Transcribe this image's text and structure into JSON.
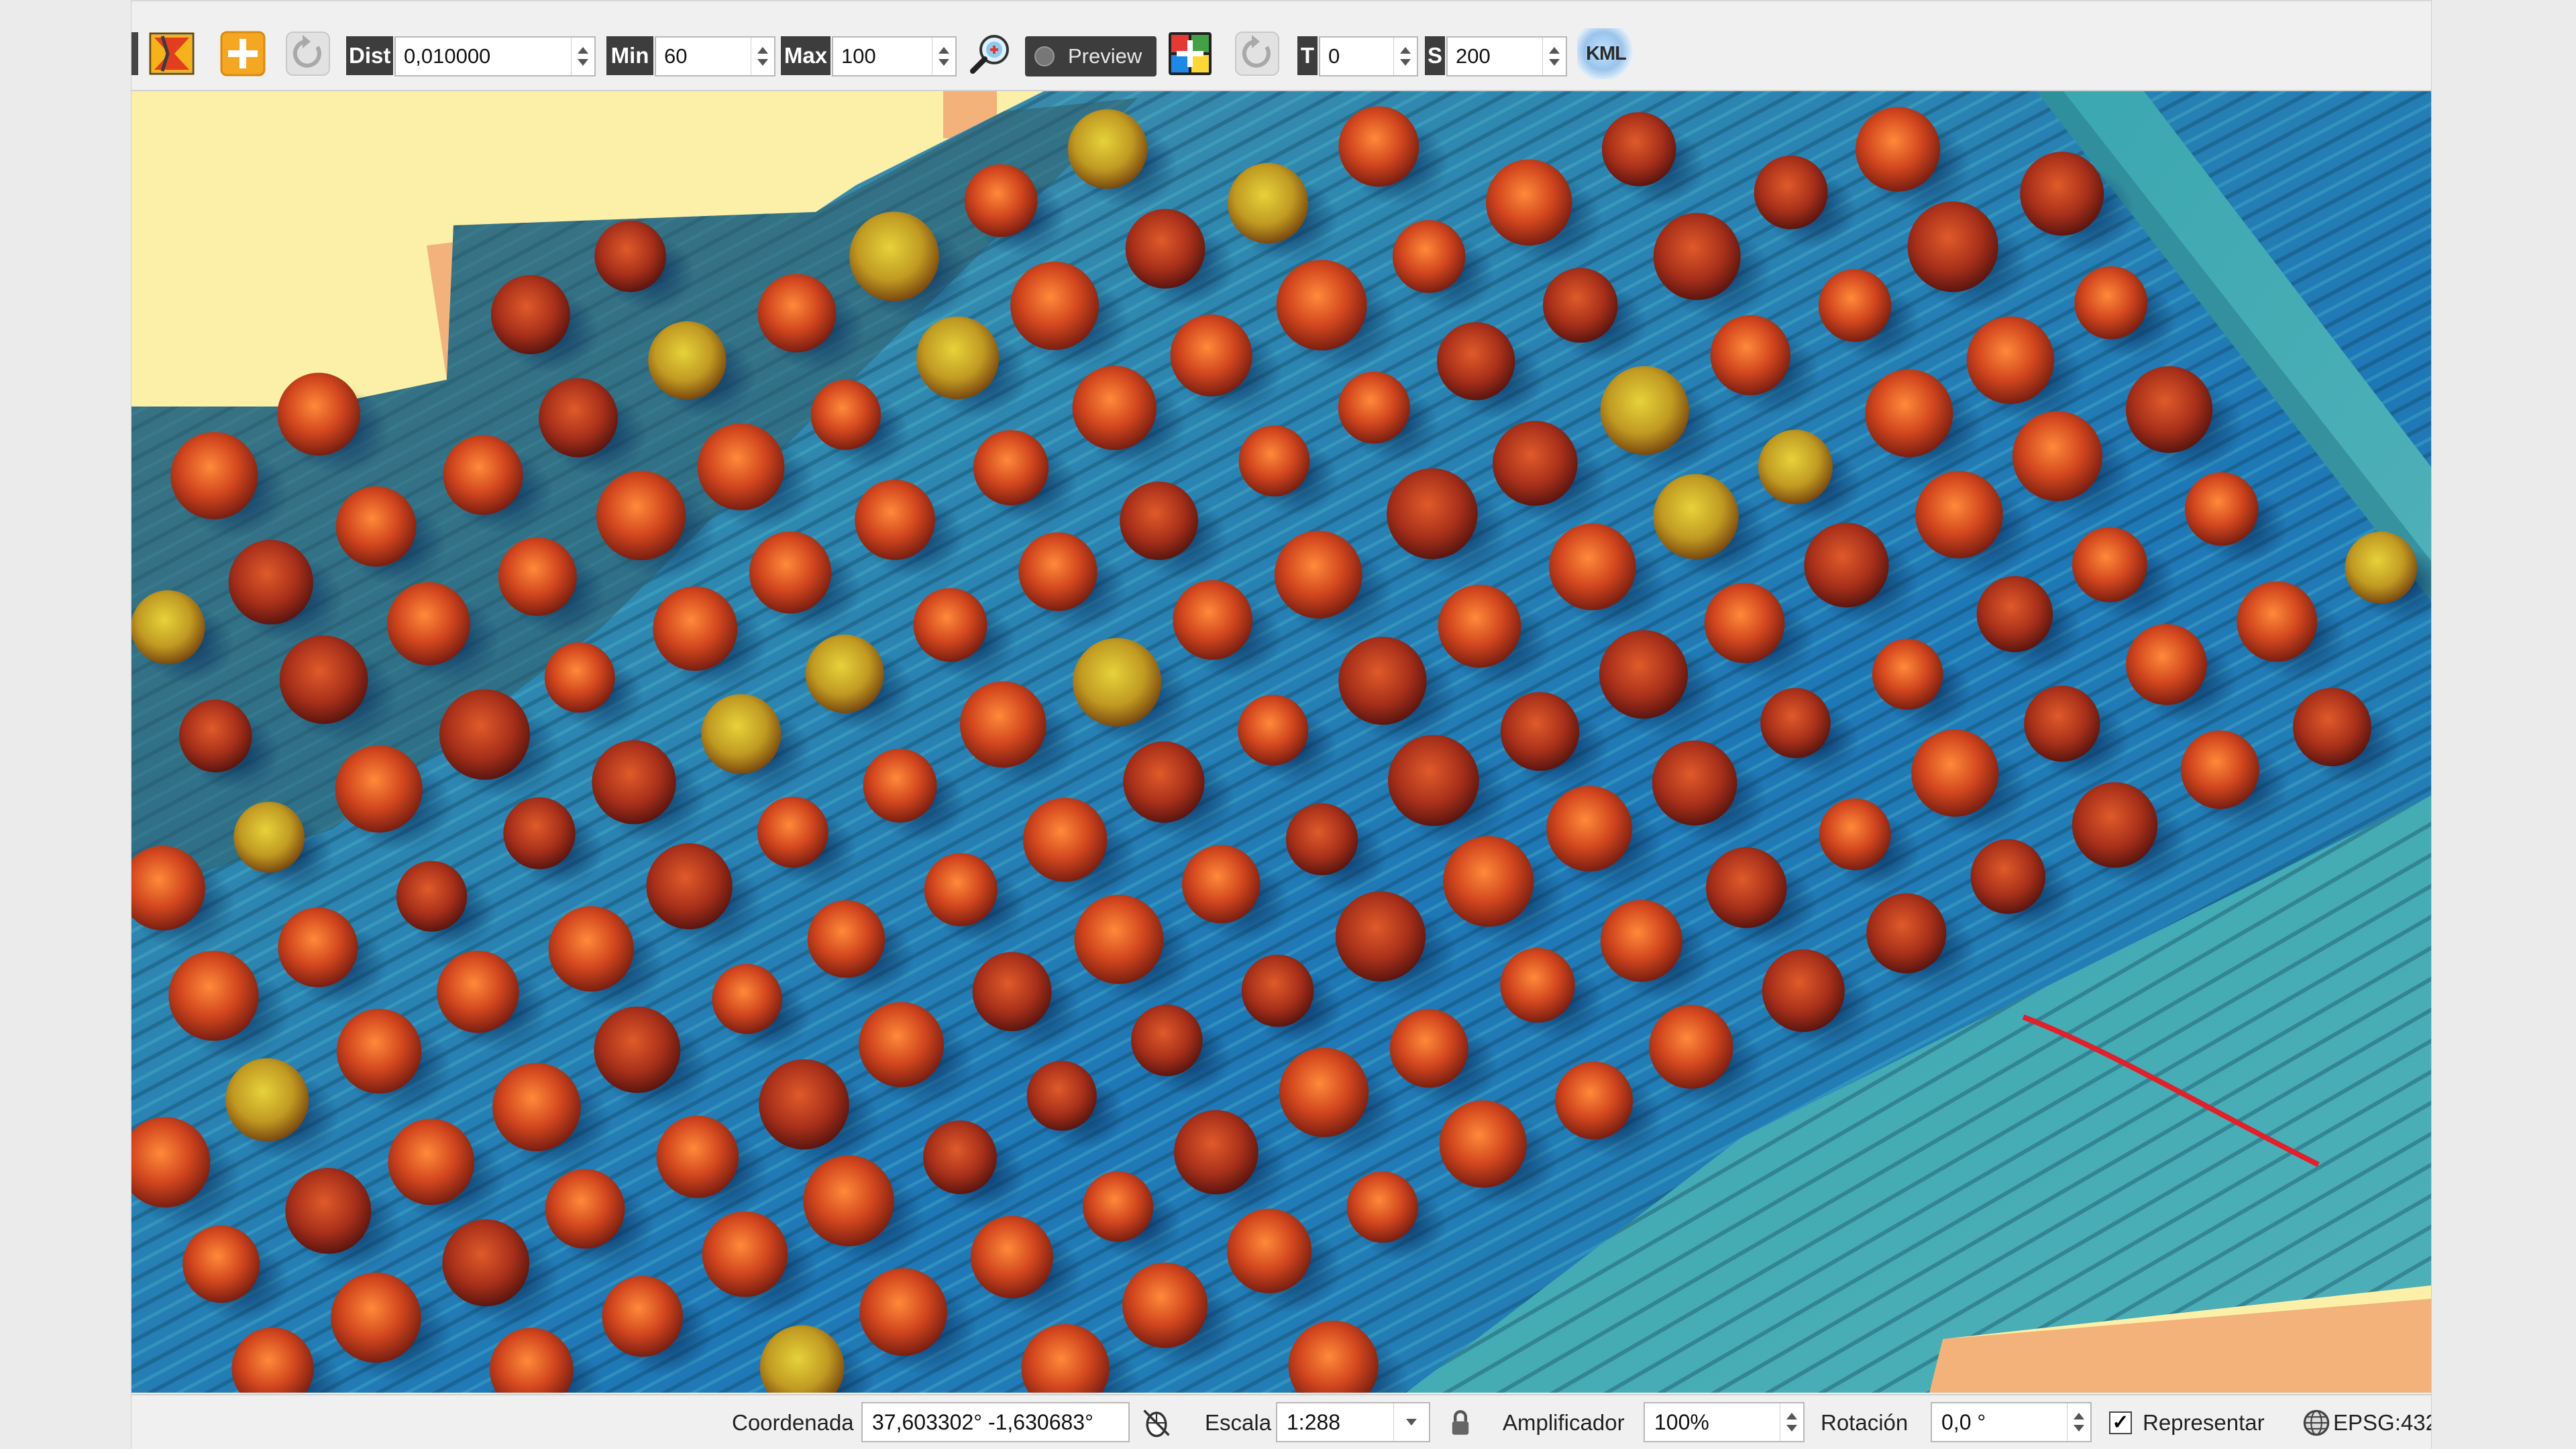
{
  "toolbar": {
    "dist_label": "Dist",
    "dist_value": "0,010000",
    "min_label": "Min",
    "min_value": "60",
    "max_label": "Max",
    "max_value": "100",
    "preview_label": "Preview",
    "t_label": "T",
    "t_value": "0",
    "s_label": "S",
    "s_value": "200",
    "kml_label": "KML",
    "icons": [
      "layer-cut-icon",
      "add-icon",
      "refresh-icon",
      "zoom-search-icon",
      "color-grid-icon",
      "refresh-icon",
      "kml-icon"
    ]
  },
  "statusbar": {
    "coord_label": "Coordenada",
    "coord_value": "37,603302° -1,630683°",
    "scale_label": "Escala",
    "scale_value": "1:288",
    "magnifier_label": "Amplificador",
    "magnifier_value": "100%",
    "rotation_label": "Rotación",
    "rotation_value": "0,0 °",
    "render_label": "Representar",
    "render_checked": true,
    "crs_label": "EPSG:432"
  },
  "colors": {
    "accent_orange": "#f5a623",
    "toolbar_label_bg": "#3d3d3d",
    "map_background": "#fcf0a8",
    "canopy": "#d2461e",
    "ground": "#2a9cc2"
  }
}
